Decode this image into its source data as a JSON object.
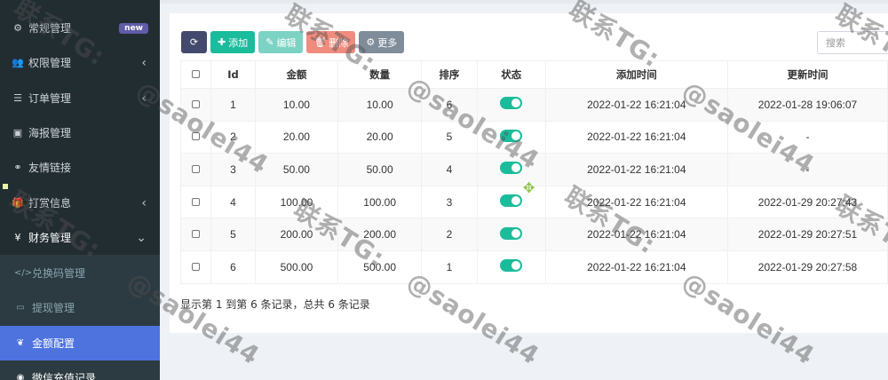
{
  "sidebar": {
    "items": [
      {
        "label": "常规管理",
        "icon": "gears-icon",
        "badge": "new"
      },
      {
        "label": "权限管理",
        "icon": "users-icon",
        "chevron": "‹"
      },
      {
        "label": "订单管理",
        "icon": "list-icon",
        "chevron": "‹"
      },
      {
        "label": "海报管理",
        "icon": "image-icon"
      },
      {
        "label": "友情链接",
        "icon": "link-icon"
      },
      {
        "label": "打赏信息",
        "icon": "gift-icon",
        "chevron": "‹"
      },
      {
        "label": "财务管理",
        "icon": "yen-icon",
        "chevron": "⌄"
      }
    ],
    "subitems": [
      {
        "label": "兑换码管理",
        "icon": "code-icon"
      },
      {
        "label": "提现管理",
        "icon": "card-icon"
      },
      {
        "label": "金额配置",
        "icon": "leaf-icon"
      },
      {
        "label": "微信充值记录",
        "icon": "wechat-icon"
      }
    ]
  },
  "toolbar": {
    "add_label": "添加",
    "edit_label": "编辑",
    "delete_label": "删除",
    "more_label": "更多"
  },
  "search": {
    "placeholder": "搜索"
  },
  "table": {
    "headers": [
      "Id",
      "金额",
      "数量",
      "排序",
      "状态",
      "添加时间",
      "更新时间"
    ],
    "rows": [
      {
        "id": "1",
        "amount": "10.00",
        "quantity": "10.00",
        "sort": "6",
        "add_time": "2022-01-22 16:21:04",
        "update_time": "2022-01-28 19:06:07"
      },
      {
        "id": "2",
        "amount": "20.00",
        "quantity": "20.00",
        "sort": "5",
        "add_time": "2022-01-22 16:21:04",
        "update_time": "-"
      },
      {
        "id": "3",
        "amount": "50.00",
        "quantity": "50.00",
        "sort": "4",
        "add_time": "2022-01-22 16:21:04",
        "update_time": "-"
      },
      {
        "id": "4",
        "amount": "100.00",
        "quantity": "100.00",
        "sort": "3",
        "add_time": "2022-01-22 16:21:04",
        "update_time": "2022-01-29 20:27:43"
      },
      {
        "id": "5",
        "amount": "200.00",
        "quantity": "200.00",
        "sort": "2",
        "add_time": "2022-01-22 16:21:04",
        "update_time": "2022-01-29 20:27:51"
      },
      {
        "id": "6",
        "amount": "500.00",
        "quantity": "500.00",
        "sort": "1",
        "add_time": "2022-01-22 16:21:04",
        "update_time": "2022-01-29 20:27:58"
      }
    ]
  },
  "pagination": {
    "summary": "显示第 1 到第 6 条记录，总共 6 条记录"
  },
  "watermark": {
    "line1": "联系TG:",
    "line2": "@saolei44"
  },
  "colors": {
    "sidebar_bg": "#222d32",
    "active": "#4e73df",
    "accent": "#1abc9c"
  }
}
